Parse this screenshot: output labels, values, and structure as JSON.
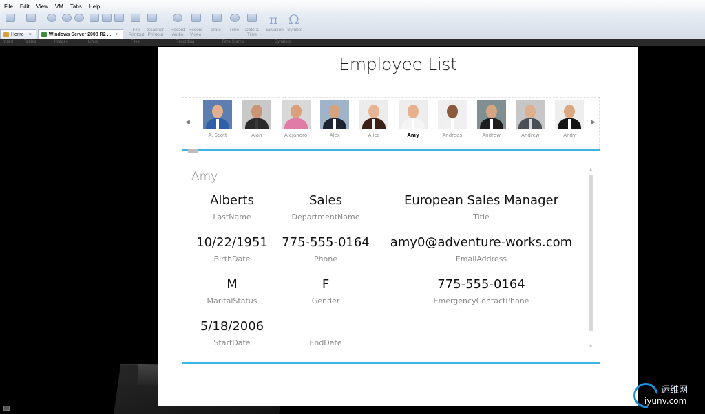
{
  "menu": [
    "File",
    "Edit",
    "View",
    "VM",
    "Tabs",
    "Help"
  ],
  "ribbon": {
    "labels": [
      {
        "text": "File Printout",
        "key": "file_printout"
      },
      {
        "text": "Scanner Printout",
        "key": "scanner_printout"
      },
      {
        "text": "Record Audio",
        "key": "record_audio"
      },
      {
        "text": "Record Video",
        "key": "record_video"
      },
      {
        "text": "Date",
        "key": "date"
      },
      {
        "text": "Time",
        "key": "time"
      },
      {
        "text": "Date & Time",
        "key": "date_time"
      },
      {
        "text": "Equation",
        "key": "equation"
      },
      {
        "text": "Symbol",
        "key": "symbol"
      }
    ],
    "tabs": [
      {
        "label": "Home",
        "close": "×"
      },
      {
        "label": "Windows Server 2008 R2 ...",
        "close": "×"
      }
    ],
    "groups": [
      "Insert",
      "Tables",
      "Images",
      "Links",
      "Files",
      "Recording",
      "Time Stamp",
      "Symbols"
    ]
  },
  "app": {
    "title": "Employee List",
    "nav_left": "◀",
    "nav_right": "▶",
    "employees": [
      {
        "name": "A. Scott",
        "skin": "#e2b08e",
        "suit": "#2e5fa8",
        "shirt": "#ffffff",
        "bg": "#5d7fb0"
      },
      {
        "name": "Alan",
        "skin": "#c99574",
        "suit": "#2a2a2a",
        "shirt": "#3a3a3a",
        "bg": "#c9c9c9"
      },
      {
        "name": "Alejandro",
        "skin": "#d9a07a",
        "suit": "#e07aa6",
        "shirt": "#e07aa6",
        "bg": "#d8d8d8"
      },
      {
        "name": "Alex",
        "skin": "#d3a27f",
        "suit": "#1d2430",
        "shirt": "#ffffff",
        "bg": "#9fb3c9"
      },
      {
        "name": "Alice",
        "skin": "#e7b593",
        "suit": "#3b2016",
        "shirt": "#f2f2f2",
        "bg": "#ececec"
      },
      {
        "name": "Amy",
        "skin": "#e6b18e",
        "suit": "#f4f4f4",
        "shirt": "#ffffff",
        "bg": "#ededed"
      },
      {
        "name": "Andreas",
        "skin": "#8b5a3c",
        "suit": "#f0f0f0",
        "shirt": "#ffffff",
        "bg": "#efefef"
      },
      {
        "name": "Andrew",
        "skin": "#d8a583",
        "suit": "#1e1e1e",
        "shirt": "#ffffff",
        "bg": "#7f8f92"
      },
      {
        "name": "Andrew",
        "skin": "#deaf8d",
        "suit": "#4a4f57",
        "shirt": "#d9d9d9",
        "bg": "#c7c7c7"
      },
      {
        "name": "Andy",
        "skin": "#dca882",
        "suit": "#151515",
        "shirt": "#ffffff",
        "bg": "#eeeeee"
      }
    ],
    "selected_index": 5,
    "selected_name": "Amy",
    "fields": {
      "last_name": {
        "value": "Alberts",
        "label": "LastName"
      },
      "department": {
        "value": "Sales",
        "label": "DepartmentName"
      },
      "title": {
        "value": "European Sales Manager",
        "label": "Title"
      },
      "birth_date": {
        "value": "10/22/1951",
        "label": "BirthDate"
      },
      "phone": {
        "value": "775-555-0164",
        "label": "Phone"
      },
      "email": {
        "value": "amy0@adventure-works.com",
        "label": "EmailAddress"
      },
      "marital_status": {
        "value": "M",
        "label": "MaritalStatus"
      },
      "gender": {
        "value": "F",
        "label": "Gender"
      },
      "emergency_phone": {
        "value": "775-555-0164",
        "label": "EmergencyContactPhone"
      },
      "start_date": {
        "value": "5/18/2006",
        "label": "StartDate"
      },
      "end_date": {
        "value": "",
        "label": "EndDate"
      }
    },
    "scroll_up": "▲",
    "scroll_down": "▼"
  },
  "watermark": {
    "cn": "运维网",
    "url": "iyunv.com"
  },
  "colors": {
    "accent": "#3cb4e5",
    "background": "#000000",
    "panel": "#ffffff"
  }
}
